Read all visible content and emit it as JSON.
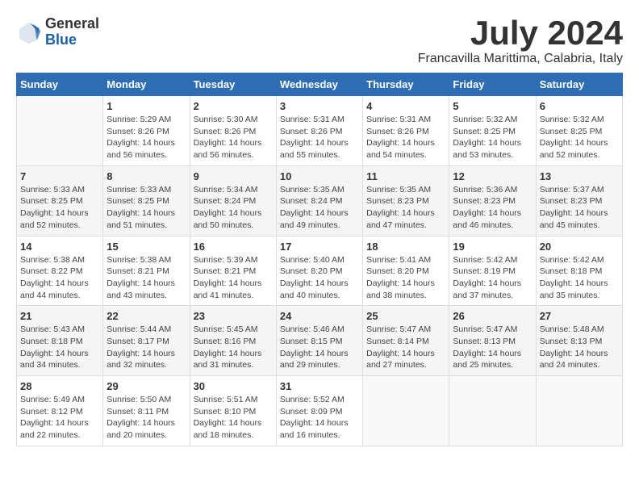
{
  "header": {
    "logo": {
      "general": "General",
      "blue": "Blue"
    },
    "month": "July 2024",
    "location": "Francavilla Marittima, Calabria, Italy"
  },
  "weekdays": [
    "Sunday",
    "Monday",
    "Tuesday",
    "Wednesday",
    "Thursday",
    "Friday",
    "Saturday"
  ],
  "weeks": [
    [
      {
        "day": "",
        "info": ""
      },
      {
        "day": "1",
        "info": "Sunrise: 5:29 AM\nSunset: 8:26 PM\nDaylight: 14 hours\nand 56 minutes."
      },
      {
        "day": "2",
        "info": "Sunrise: 5:30 AM\nSunset: 8:26 PM\nDaylight: 14 hours\nand 56 minutes."
      },
      {
        "day": "3",
        "info": "Sunrise: 5:31 AM\nSunset: 8:26 PM\nDaylight: 14 hours\nand 55 minutes."
      },
      {
        "day": "4",
        "info": "Sunrise: 5:31 AM\nSunset: 8:26 PM\nDaylight: 14 hours\nand 54 minutes."
      },
      {
        "day": "5",
        "info": "Sunrise: 5:32 AM\nSunset: 8:25 PM\nDaylight: 14 hours\nand 53 minutes."
      },
      {
        "day": "6",
        "info": "Sunrise: 5:32 AM\nSunset: 8:25 PM\nDaylight: 14 hours\nand 52 minutes."
      }
    ],
    [
      {
        "day": "7",
        "info": "Sunrise: 5:33 AM\nSunset: 8:25 PM\nDaylight: 14 hours\nand 52 minutes."
      },
      {
        "day": "8",
        "info": "Sunrise: 5:33 AM\nSunset: 8:25 PM\nDaylight: 14 hours\nand 51 minutes."
      },
      {
        "day": "9",
        "info": "Sunrise: 5:34 AM\nSunset: 8:24 PM\nDaylight: 14 hours\nand 50 minutes."
      },
      {
        "day": "10",
        "info": "Sunrise: 5:35 AM\nSunset: 8:24 PM\nDaylight: 14 hours\nand 49 minutes."
      },
      {
        "day": "11",
        "info": "Sunrise: 5:35 AM\nSunset: 8:23 PM\nDaylight: 14 hours\nand 47 minutes."
      },
      {
        "day": "12",
        "info": "Sunrise: 5:36 AM\nSunset: 8:23 PM\nDaylight: 14 hours\nand 46 minutes."
      },
      {
        "day": "13",
        "info": "Sunrise: 5:37 AM\nSunset: 8:23 PM\nDaylight: 14 hours\nand 45 minutes."
      }
    ],
    [
      {
        "day": "14",
        "info": "Sunrise: 5:38 AM\nSunset: 8:22 PM\nDaylight: 14 hours\nand 44 minutes."
      },
      {
        "day": "15",
        "info": "Sunrise: 5:38 AM\nSunset: 8:21 PM\nDaylight: 14 hours\nand 43 minutes."
      },
      {
        "day": "16",
        "info": "Sunrise: 5:39 AM\nSunset: 8:21 PM\nDaylight: 14 hours\nand 41 minutes."
      },
      {
        "day": "17",
        "info": "Sunrise: 5:40 AM\nSunset: 8:20 PM\nDaylight: 14 hours\nand 40 minutes."
      },
      {
        "day": "18",
        "info": "Sunrise: 5:41 AM\nSunset: 8:20 PM\nDaylight: 14 hours\nand 38 minutes."
      },
      {
        "day": "19",
        "info": "Sunrise: 5:42 AM\nSunset: 8:19 PM\nDaylight: 14 hours\nand 37 minutes."
      },
      {
        "day": "20",
        "info": "Sunrise: 5:42 AM\nSunset: 8:18 PM\nDaylight: 14 hours\nand 35 minutes."
      }
    ],
    [
      {
        "day": "21",
        "info": "Sunrise: 5:43 AM\nSunset: 8:18 PM\nDaylight: 14 hours\nand 34 minutes."
      },
      {
        "day": "22",
        "info": "Sunrise: 5:44 AM\nSunset: 8:17 PM\nDaylight: 14 hours\nand 32 minutes."
      },
      {
        "day": "23",
        "info": "Sunrise: 5:45 AM\nSunset: 8:16 PM\nDaylight: 14 hours\nand 31 minutes."
      },
      {
        "day": "24",
        "info": "Sunrise: 5:46 AM\nSunset: 8:15 PM\nDaylight: 14 hours\nand 29 minutes."
      },
      {
        "day": "25",
        "info": "Sunrise: 5:47 AM\nSunset: 8:14 PM\nDaylight: 14 hours\nand 27 minutes."
      },
      {
        "day": "26",
        "info": "Sunrise: 5:47 AM\nSunset: 8:13 PM\nDaylight: 14 hours\nand 25 minutes."
      },
      {
        "day": "27",
        "info": "Sunrise: 5:48 AM\nSunset: 8:13 PM\nDaylight: 14 hours\nand 24 minutes."
      }
    ],
    [
      {
        "day": "28",
        "info": "Sunrise: 5:49 AM\nSunset: 8:12 PM\nDaylight: 14 hours\nand 22 minutes."
      },
      {
        "day": "29",
        "info": "Sunrise: 5:50 AM\nSunset: 8:11 PM\nDaylight: 14 hours\nand 20 minutes."
      },
      {
        "day": "30",
        "info": "Sunrise: 5:51 AM\nSunset: 8:10 PM\nDaylight: 14 hours\nand 18 minutes."
      },
      {
        "day": "31",
        "info": "Sunrise: 5:52 AM\nSunset: 8:09 PM\nDaylight: 14 hours\nand 16 minutes."
      },
      {
        "day": "",
        "info": ""
      },
      {
        "day": "",
        "info": ""
      },
      {
        "day": "",
        "info": ""
      }
    ]
  ]
}
